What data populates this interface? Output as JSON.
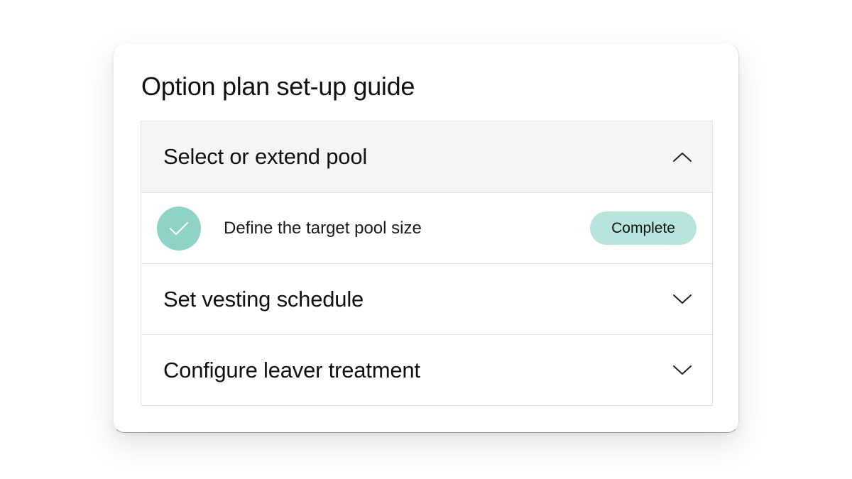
{
  "guide": {
    "title": "Option plan set-up guide",
    "sections": [
      {
        "label": "Select or extend pool",
        "expanded": true,
        "chevron_icon": "chevron-up-icon",
        "steps": [
          {
            "label": "Define the target pool size",
            "status": "Complete",
            "status_icon": "check-icon"
          }
        ]
      },
      {
        "label": "Set vesting schedule",
        "expanded": false,
        "chevron_icon": "chevron-down-icon"
      },
      {
        "label": "Configure leaver treatment",
        "expanded": false,
        "chevron_icon": "chevron-down-icon"
      }
    ]
  },
  "colors": {
    "accent": "#8ed3c6",
    "badge_background": "#b7e4dc",
    "expanded_header_background": "#f7f5f3",
    "border": "#e6e1de"
  }
}
